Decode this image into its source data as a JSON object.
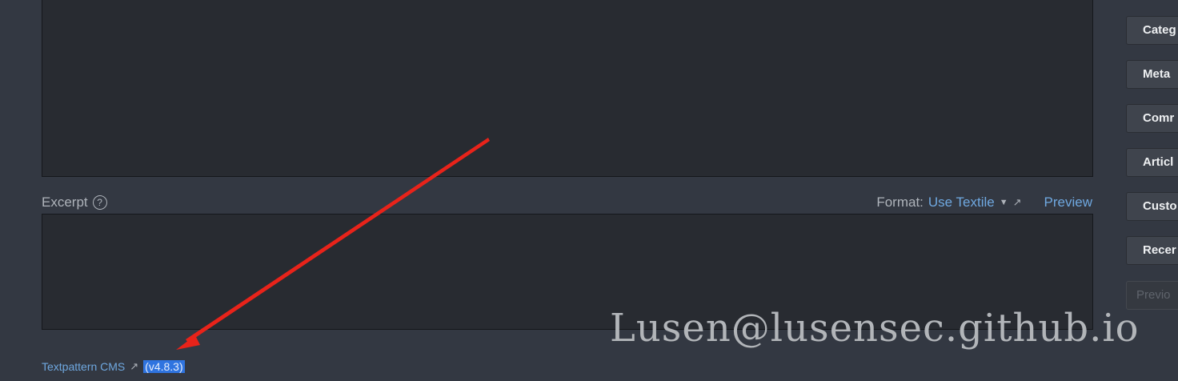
{
  "excerpt": {
    "label": "Excerpt",
    "help_icon": "?"
  },
  "format": {
    "label": "Format:",
    "value": "Use Textile",
    "preview": "Preview"
  },
  "footer": {
    "cms_link": "Textpattern CMS",
    "version": "(v4.8.3)"
  },
  "sidebar": {
    "buttons": [
      "Categ",
      "Meta",
      "Comr",
      "Articl",
      "Custo",
      "Recer"
    ],
    "preview_btn": "Previo"
  },
  "watermark": "Lusen@lusensec.github.io",
  "colors": {
    "background": "#333842",
    "textarea": "#282b31",
    "link": "#6fa8e0",
    "highlight": "#2f74e0",
    "arrow": "#e8231a"
  }
}
